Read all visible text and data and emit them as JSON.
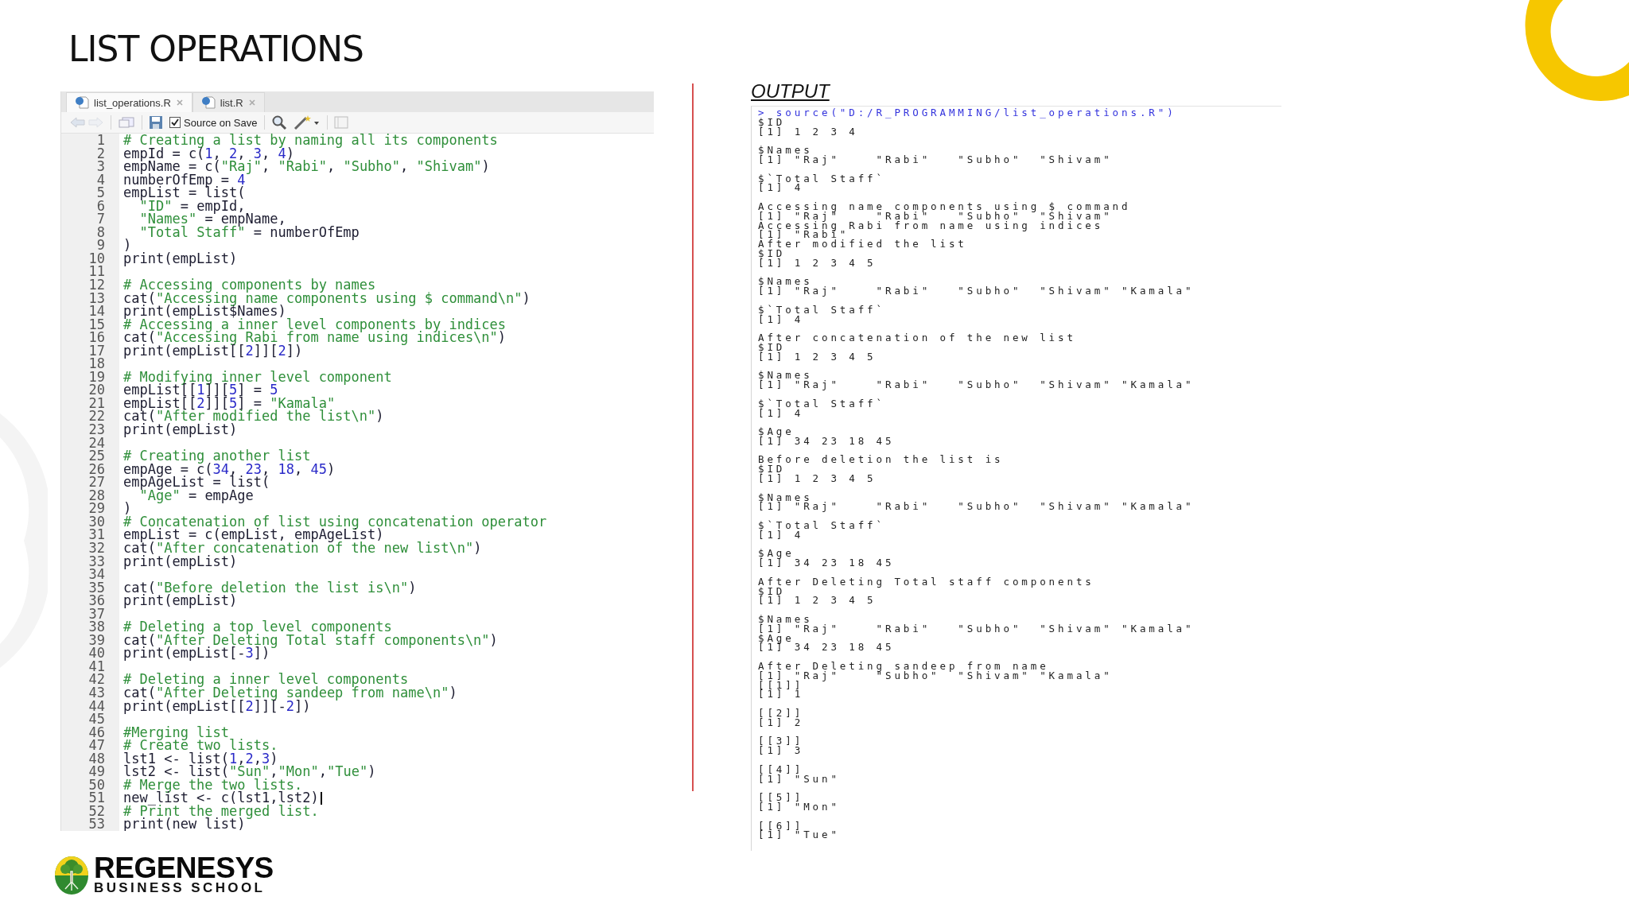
{
  "slide": {
    "title": "LIST OPERATIONS"
  },
  "editor": {
    "tabs": [
      {
        "label": "list_operations.R",
        "selected": true
      },
      {
        "label": "list.R",
        "selected": false
      }
    ],
    "toolbar": {
      "source_on_save": {
        "label": "Source on Save",
        "checked": true
      }
    },
    "lines": [
      {
        "n": "1",
        "code": "# Creating a list by naming all its components"
      },
      {
        "n": "2",
        "code": "empId = c(1, 2, 3, 4)"
      },
      {
        "n": "3",
        "code": "empName = c(\"Raj\", \"Rabi\", \"Subho\", \"Shivam\")"
      },
      {
        "n": "4",
        "code": "numberOfEmp = 4"
      },
      {
        "n": "5",
        "code": "empList = list("
      },
      {
        "n": "6",
        "code": "  \"ID\" = empId,"
      },
      {
        "n": "7",
        "code": "  \"Names\" = empName,"
      },
      {
        "n": "8",
        "code": "  \"Total Staff\" = numberOfEmp"
      },
      {
        "n": "9",
        "code": ")"
      },
      {
        "n": "10",
        "code": "print(empList)"
      },
      {
        "n": "11"
      },
      {
        "n": "12",
        "code": "# Accessing components by names"
      },
      {
        "n": "13",
        "code": "cat(\"Accessing name components using $ command\\n\")"
      },
      {
        "n": "14",
        "code": "print(empList$Names)"
      },
      {
        "n": "15",
        "code": "# Accessing a inner level components by indices"
      },
      {
        "n": "16",
        "code": "cat(\"Accessing Rabi from name using indices\\n\")"
      },
      {
        "n": "17",
        "code": "print(empList[[2]][2])"
      },
      {
        "n": "18"
      },
      {
        "n": "19",
        "code": "# Modifying inner level component"
      },
      {
        "n": "20",
        "code": "empList[[1]][5] = 5"
      },
      {
        "n": "21",
        "code": "empList[[2]][5] = \"Kamala\""
      },
      {
        "n": "22",
        "code": "cat(\"After modified the list\\n\")"
      },
      {
        "n": "23",
        "code": "print(empList)"
      },
      {
        "n": "24"
      },
      {
        "n": "25",
        "code": "# Creating another list"
      },
      {
        "n": "26",
        "code": "empAge = c(34, 23, 18, 45)"
      },
      {
        "n": "27",
        "code": "empAgeList = list("
      },
      {
        "n": "28",
        "code": "  \"Age\" = empAge"
      },
      {
        "n": "29",
        "code": ")"
      },
      {
        "n": "30",
        "code": "# Concatenation of list using concatenation operator"
      },
      {
        "n": "31",
        "code": "empList = c(empList, empAgeList)"
      },
      {
        "n": "32",
        "code": "cat(\"After concatenation of the new list\\n\")"
      },
      {
        "n": "33",
        "code": "print(empList)"
      },
      {
        "n": "34"
      },
      {
        "n": "35",
        "code": "cat(\"Before deletion the list is\\n\")"
      },
      {
        "n": "36",
        "code": "print(empList)"
      },
      {
        "n": "37"
      },
      {
        "n": "38",
        "code": "# Deleting a top level components"
      },
      {
        "n": "39",
        "code": "cat(\"After Deleting Total staff components\\n\")"
      },
      {
        "n": "40",
        "code": "print(empList[-3])"
      },
      {
        "n": "41"
      },
      {
        "n": "42",
        "code": "# Deleting a inner level components"
      },
      {
        "n": "43",
        "code": "cat(\"After Deleting sandeep from name\\n\")"
      },
      {
        "n": "44",
        "code": "print(empList[[2]][-2])"
      },
      {
        "n": "45"
      },
      {
        "n": "46",
        "code": "#Merging list"
      },
      {
        "n": "47",
        "code": "# Create two lists."
      },
      {
        "n": "48",
        "code": "lst1 <- list(1,2,3)"
      },
      {
        "n": "49",
        "code": "lst2 <- list(\"Sun\",\"Mon\",\"Tue\")"
      },
      {
        "n": "50",
        "code": "# Merge the two lists."
      },
      {
        "n": "51",
        "code": "new_list <- c(lst1,lst2)",
        "cursor": true
      },
      {
        "n": "52",
        "code": "# Print the merged list."
      },
      {
        "n": "53",
        "code": "print(new_list)"
      }
    ]
  },
  "output": {
    "heading": "OUTPUT",
    "command": "> source(\"D:/R_PROGRAMMING/list_operations.R\")",
    "blocks": [
      [
        "$ID",
        "[1] 1 2 3 4"
      ],
      [
        "$Names",
        "[1] \"Raj\"    \"Rabi\"   \"Subho\"  \"Shivam\""
      ],
      [
        "$`Total Staff`",
        "[1] 4"
      ],
      [
        "Accessing name components using $ command",
        "[1] \"Raj\"    \"Rabi\"   \"Subho\"  \"Shivam\"",
        "Accessing Rabi from name using indices",
        "[1] \"Rabi\"",
        "After modified the list",
        "$ID",
        "[1] 1 2 3 4 5"
      ],
      [
        "$Names",
        "[1] \"Raj\"    \"Rabi\"   \"Subho\"  \"Shivam\" \"Kamala\""
      ],
      [
        "$`Total Staff`",
        "[1] 4"
      ],
      [
        "After concatenation of the new list",
        "$ID",
        "[1] 1 2 3 4 5"
      ],
      [
        "$Names",
        "[1] \"Raj\"    \"Rabi\"   \"Subho\"  \"Shivam\" \"Kamala\""
      ],
      [
        "$`Total Staff`",
        "[1] 4"
      ],
      [
        "$Age",
        "[1] 34 23 18 45"
      ],
      [
        "Before deletion the list is",
        "$ID",
        "[1] 1 2 3 4 5"
      ],
      [
        "$Names",
        "[1] \"Raj\"    \"Rabi\"   \"Subho\"  \"Shivam\" \"Kamala\""
      ],
      [
        "$`Total Staff`",
        "[1] 4"
      ],
      [
        "$Age",
        "[1] 34 23 18 45"
      ],
      [
        "After Deleting Total staff components",
        "$ID",
        "[1] 1 2 3 4 5"
      ],
      [
        "$Names",
        "[1] \"Raj\"    \"Rabi\"   \"Subho\"  \"Shivam\" \"Kamala\"",
        "$Age",
        "[1] 34 23 18 45"
      ],
      [
        "After Deleting sandeep from name",
        "[1] \"Raj\"    \"Subho\"  \"Shivam\" \"Kamala\"",
        "[[1]]",
        "[1] 1"
      ],
      [
        "[[2]]",
        "[1] 2"
      ],
      [
        "[[3]]",
        "[1] 3"
      ],
      [
        "[[4]]",
        "[1] \"Sun\""
      ],
      [
        "[[5]]",
        "[1] \"Mon\""
      ],
      [
        "[[6]]",
        "[1] \"Tue\""
      ]
    ]
  },
  "logo": {
    "name": "REGENESYS",
    "subtitle": "BUSINESS SCHOOL"
  }
}
